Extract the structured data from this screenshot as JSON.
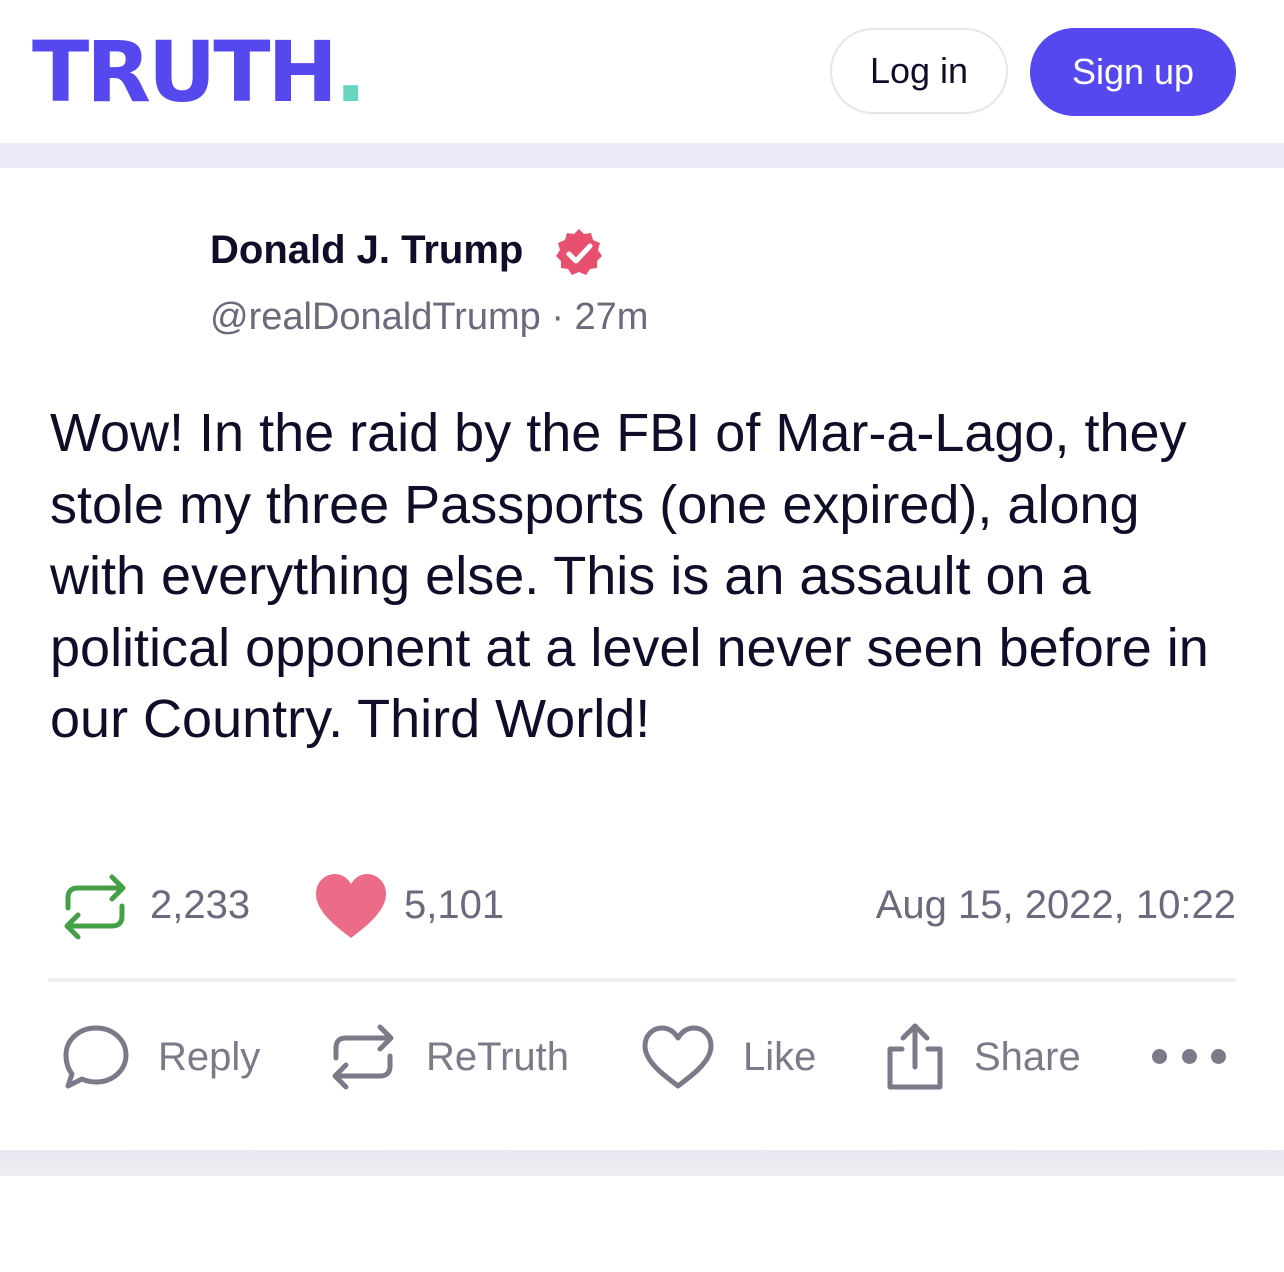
{
  "header": {
    "logo_text": "TRUTH",
    "logo_dot": ".",
    "login_label": "Log in",
    "signup_label": "Sign up"
  },
  "post": {
    "author_name": "Donald J. Trump",
    "handle": "@realDonaldTrump",
    "separator": "·",
    "relative_time": "27m",
    "text": "Wow! In the raid by the FBI of Mar-a-Lago, they stole my three Passports (one expired), along with everything else. This is an assault on a political opponent at a level never seen before in our Country. Third World!",
    "retruth_count": "2,233",
    "like_count": "5,101",
    "timestamp": "Aug 15, 2022, 10:22"
  },
  "actions": {
    "reply_label": "Reply",
    "retruth_label": "ReTruth",
    "like_label": "Like",
    "share_label": "Share"
  },
  "colors": {
    "brand": "#5448ee",
    "logo_dot": "#66d6c0",
    "verified": "#e8506f",
    "retruth_green": "#43a047",
    "like_pink": "#ec6b86"
  },
  "icons": [
    "verified-badge-icon",
    "retruth-icon",
    "heart-icon",
    "reply-icon",
    "share-icon",
    "more-icon"
  ]
}
